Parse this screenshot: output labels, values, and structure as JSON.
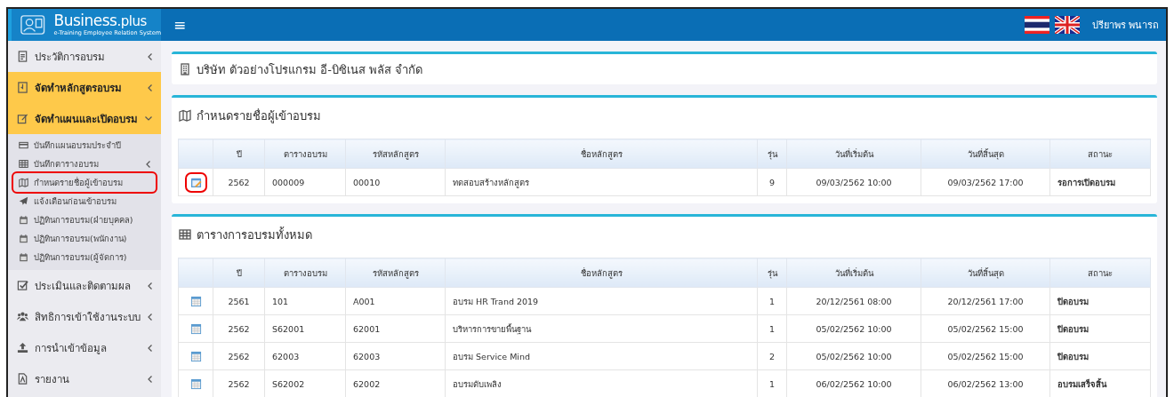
{
  "header": {
    "logo_title": "Business",
    "logo_suffix": ".plus",
    "logo_subtitle": "e-Training Employee Relation System",
    "menu_toggle": "≡",
    "user_name": "ปรียาพร พนารถ"
  },
  "sidebar": {
    "items": [
      {
        "label": "ประวัติการอบรม",
        "selected": false,
        "expanded": false
      },
      {
        "label": "จัดทำหลักสูตรอบรม",
        "selected": true,
        "expanded": false
      },
      {
        "label": "จัดทำแผนและเปิดอบรม",
        "selected": true,
        "expanded": true,
        "children": [
          {
            "label": "บันทึกแผนอบรมประจำปี",
            "has_submenu": false,
            "annotated": false
          },
          {
            "label": "บันทึกตารางอบรม",
            "has_submenu": true,
            "annotated": false
          },
          {
            "label": "กำหนดรายชื่อผู้เข้าอบรม",
            "has_submenu": false,
            "annotated": true
          },
          {
            "label": "แจ้งเตือนก่อนเข้าอบรม",
            "has_submenu": false,
            "annotated": false
          },
          {
            "label": "ปฏิทินการอบรม(ฝ่ายบุคคล)",
            "has_submenu": false,
            "annotated": false
          },
          {
            "label": "ปฏิทินการอบรม(พนักงาน)",
            "has_submenu": false,
            "annotated": false
          },
          {
            "label": "ปฏิทินการอบรม(ผู้จัดการ)",
            "has_submenu": false,
            "annotated": false
          }
        ]
      },
      {
        "label": "ประเมินและติดตามผล",
        "selected": false,
        "expanded": false
      },
      {
        "label": "สิทธิการเข้าใช้งานระบบ",
        "selected": false,
        "expanded": false
      },
      {
        "label": "การนำเข้าข้อมูล",
        "selected": false,
        "expanded": false
      },
      {
        "label": "รายงาน",
        "selected": false,
        "expanded": false
      }
    ]
  },
  "cards": [
    {
      "kind": "title",
      "title": "บริษัท ตัวอย่างโปรแกรม อี-บิซิเนส พลัส จำกัด"
    },
    {
      "kind": "edit_table",
      "title": "กำหนดรายชื่อผู้เข้าอบรม",
      "columns": [
        "ปี",
        "ตารางอบรม",
        "รหัสหลักสูตร",
        "ชื่อหลักสูตร",
        "รุ่น",
        "วันที่เริ่มต้น",
        "วันที่สิ้นสุด",
        "สถานะ"
      ],
      "rows": [
        {
          "annotated": true,
          "cells": [
            "2562",
            "000009",
            "00010",
            "ทดสอบสร้างหลักสูตร",
            "9",
            "09/03/2562 10:00",
            "09/03/2562 17:00",
            "รอการเปิดอบรม"
          ]
        }
      ]
    },
    {
      "kind": "view_table",
      "title": "ตารางการอบรมทั้งหมด",
      "columns": [
        "ปี",
        "ตารางอบรม",
        "รหัสหลักสูตร",
        "ชื่อหลักสูตร",
        "รุ่น",
        "วันที่เริ่มต้น",
        "วันที่สิ้นสุด",
        "สถานะ"
      ],
      "rows": [
        {
          "annotated": false,
          "cells": [
            "2561",
            "101",
            "A001",
            "อบรม HR Trand 2019",
            "1",
            "20/12/2561 08:00",
            "20/12/2561 17:00",
            "ปิดอบรม"
          ]
        },
        {
          "annotated": false,
          "cells": [
            "2562",
            "S62001",
            "62001",
            "บริหารการขายพื้นฐาน",
            "1",
            "05/02/2562 10:00",
            "05/02/2562 15:00",
            "ปิดอบรม"
          ]
        },
        {
          "annotated": false,
          "cells": [
            "2562",
            "62003",
            "62003",
            "อบรม Service Mind",
            "2",
            "05/02/2562 10:00",
            "05/02/2562 15:00",
            "ปิดอบรม"
          ]
        },
        {
          "annotated": false,
          "cells": [
            "2562",
            "S62002",
            "62002",
            "อบรมดับเพลิง",
            "1",
            "06/02/2562 10:00",
            "06/02/2562 13:00",
            "อบรมเสร็จสิ้น"
          ]
        }
      ]
    }
  ]
}
